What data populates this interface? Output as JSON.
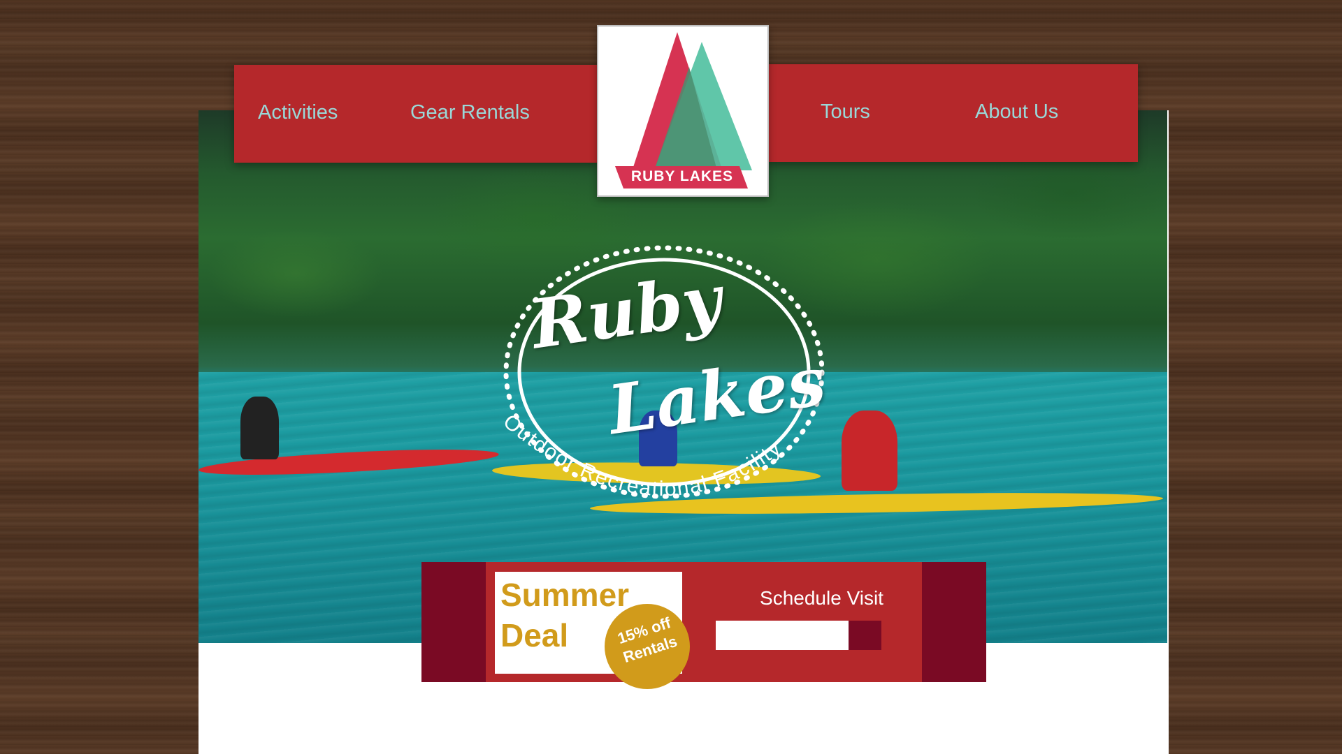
{
  "nav": {
    "left_links": [
      {
        "label": "Activities"
      },
      {
        "label": "Gear Rentals"
      }
    ],
    "right_links": [
      {
        "label": "Tours"
      },
      {
        "label": "About Us"
      }
    ]
  },
  "logo": {
    "label": "RUBY LAKES",
    "colors": {
      "left_triangle": "#d63352",
      "right_triangle": "#4fc0a0",
      "banner": "#d63352"
    }
  },
  "hero": {
    "badge_title_line1": "Ruby",
    "badge_title_line2": "Lakes",
    "badge_subtitle": "Outdoor Recreational Facility"
  },
  "promo": {
    "deal_title": "Summer\nDeal",
    "deal_badge": "15% off\nRentals",
    "schedule_label": "Schedule Visit",
    "schedule_input_value": ""
  },
  "colors": {
    "nav_bg": "#b5282b",
    "nav_text": "#9ad8d8",
    "promo_dark": "#7a0a24",
    "gold": "#d19b1b"
  }
}
